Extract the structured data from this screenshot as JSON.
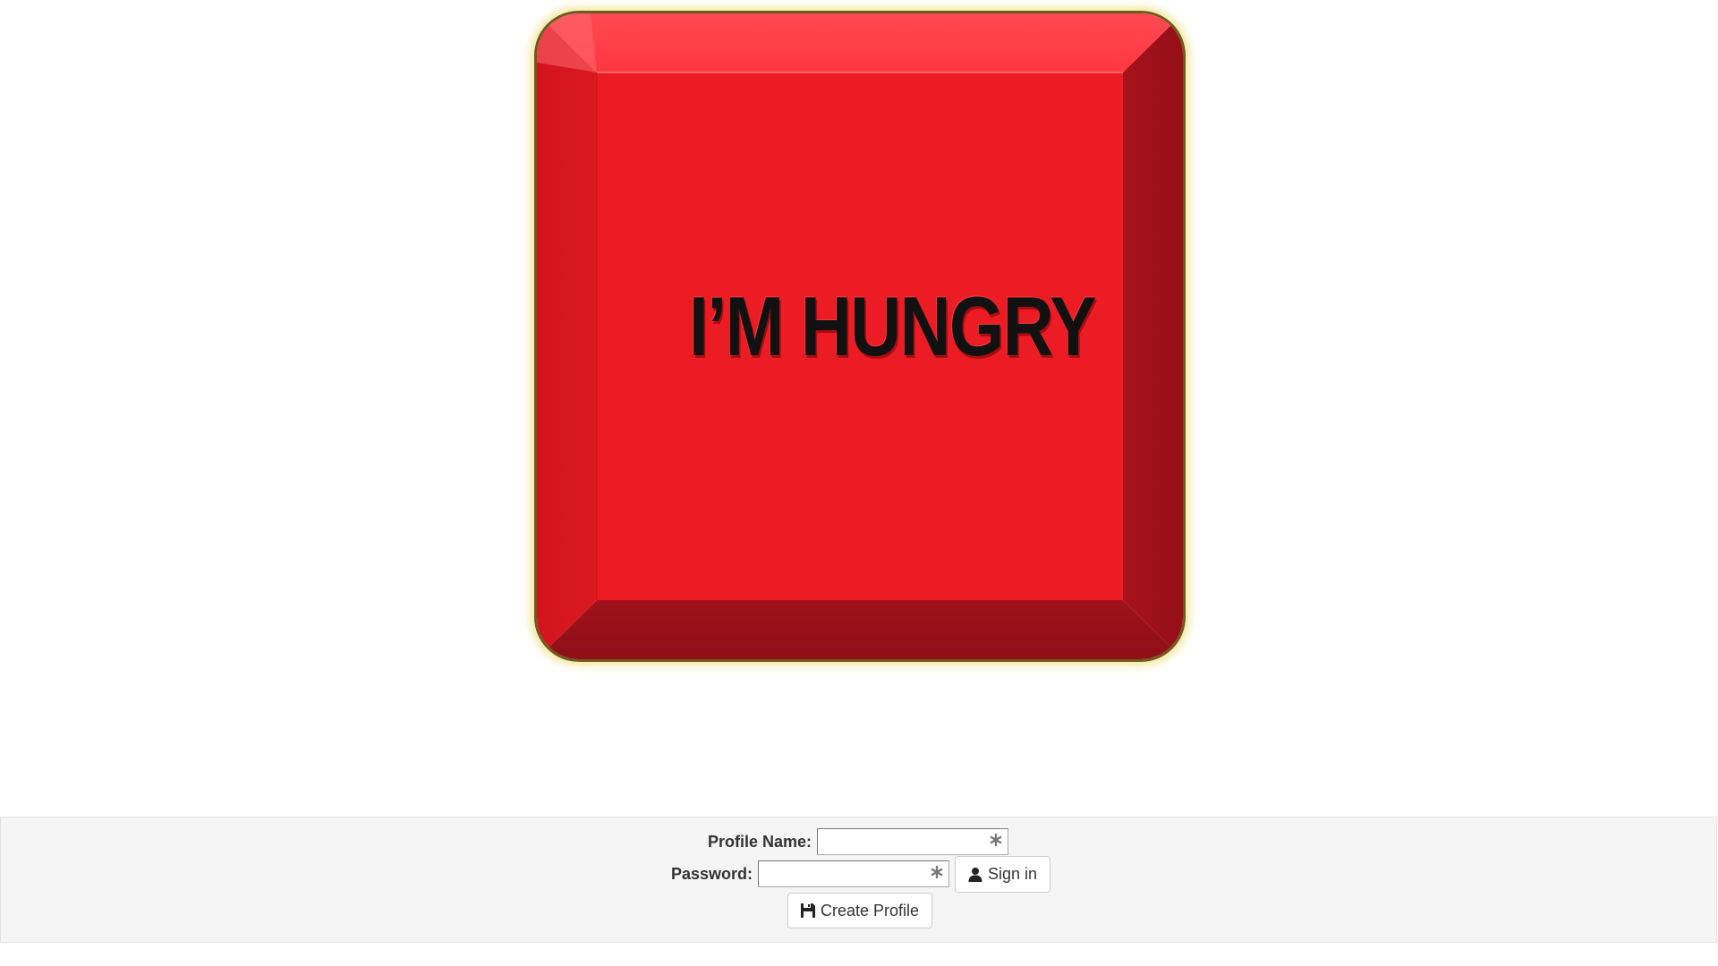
{
  "big_button": {
    "label": "I’M HUNGRY",
    "colors": {
      "face": "#ec1c24",
      "bevel_top": "#ff3b44",
      "bevel_left": "#d8161f",
      "bevel_right": "#a0121a",
      "bevel_bottom": "#9c111a",
      "glow": "#f0dc78"
    }
  },
  "login": {
    "profile_name_label": "Profile Name:",
    "profile_name_value": "",
    "password_label": "Password:",
    "password_value": "",
    "required_icon": "asterisk-icon",
    "sign_in_label": "Sign in",
    "sign_in_icon": "user-icon",
    "create_profile_label": "Create Profile",
    "create_profile_icon": "floppy-disk-icon"
  }
}
